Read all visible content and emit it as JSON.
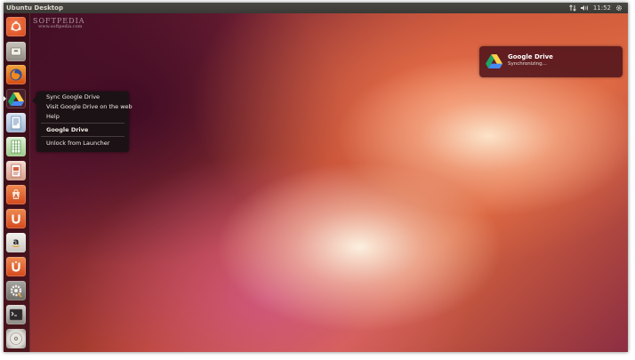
{
  "top_panel": {
    "title": "Ubuntu Desktop",
    "clock": "11:52",
    "icons": [
      "network-arrows-icon",
      "volume-icon",
      "gear-icon"
    ]
  },
  "watermark": {
    "main": "SOFTPEDIA",
    "sub": "www.softpedia.com"
  },
  "launcher": {
    "items": [
      {
        "name": "dash-home",
        "icon": "ubuntu-logo-icon"
      },
      {
        "name": "files",
        "icon": "file-cabinet-icon"
      },
      {
        "name": "firefox",
        "icon": "firefox-icon"
      },
      {
        "name": "google-drive",
        "icon": "google-drive-icon"
      },
      {
        "name": "libreoffice-writer",
        "icon": "document-icon"
      },
      {
        "name": "libreoffice-calc",
        "icon": "spreadsheet-icon"
      },
      {
        "name": "libreoffice-impress",
        "icon": "presentation-icon"
      },
      {
        "name": "ubuntu-software-center",
        "icon": "software-center-icon"
      },
      {
        "name": "ubuntu-one",
        "icon": "ubuntu-one-icon"
      },
      {
        "name": "amazon",
        "icon": "amazon-icon"
      },
      {
        "name": "ubuntu-one-music",
        "icon": "ubuntu-one-music-icon"
      },
      {
        "name": "system-settings",
        "icon": "settings-icon"
      },
      {
        "name": "terminal",
        "icon": "terminal-icon"
      },
      {
        "name": "dvd",
        "icon": "dvd-icon"
      }
    ]
  },
  "quicklist": {
    "items": [
      "Sync Google Drive",
      "Visit Google Drive on the web",
      "Help"
    ],
    "app_name": "Google Drive",
    "unlock": "Unlock from Launcher"
  },
  "notification": {
    "title": "Google Drive",
    "body": "Synchronizing..."
  },
  "colors": {
    "panel": "#3c3b37",
    "drive_green": "#1fa463",
    "drive_yellow": "#ffd04b",
    "drive_blue": "#4688f4",
    "launcher_orange": "#e2522a"
  }
}
